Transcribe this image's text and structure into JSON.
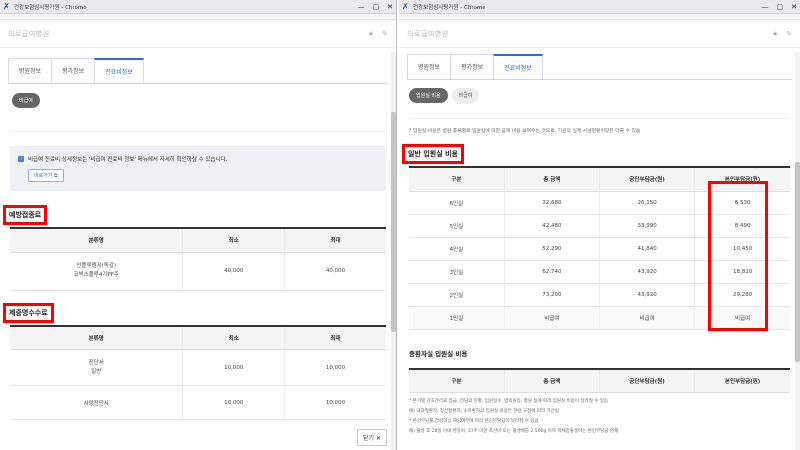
{
  "left": {
    "window_title": "건강보험심사평가원 - Chrome",
    "page_title": "의료급여병원",
    "tabs": [
      {
        "label": "병원정보"
      },
      {
        "label": "평가정보"
      },
      {
        "label": "진료비정보"
      }
    ],
    "chip": "비급여",
    "notice_text": "비급여 진료비 상세정보는 '비급여 진료비 정보' 메뉴에서 자세히 확인하실 수 있습니다.",
    "notice_button": "바로가기",
    "section1": {
      "title": "예방접종료",
      "headers": [
        "분류명",
        "최소",
        "최대"
      ],
      "rows": [
        [
          "인플루엔자(독감)\n코박스플루4가PF주",
          "40,000",
          "40,000"
        ]
      ]
    },
    "section2": {
      "title": "제증명수수료",
      "headers": [
        "분류명",
        "최소",
        "최대"
      ],
      "rows": [
        [
          "진단서\n일반",
          "10,000",
          "10,000"
        ],
        [
          "사망진단서",
          "10,000",
          "10,000"
        ]
      ]
    },
    "close_label": "닫기"
  },
  "right": {
    "window_title": "건강보험심사평가원 - Chrome",
    "page_title": "의료급여병원",
    "tabs": [
      {
        "label": "병원정보"
      },
      {
        "label": "평가정보"
      },
      {
        "label": "진료비정보"
      }
    ],
    "chips": [
      "입원실 비용",
      "비급여"
    ],
    "description": "* 입원실 비용은 병원 종류별로 입원실에 대한 금액 비용 보여주는 것으로, 기관의 실제 시설현황이랑은 다를 수 있음",
    "section1": {
      "title": "일반 입원실 비용",
      "headers": [
        "구분",
        "총 금액",
        "공단부담금(원)",
        "본인부담금(원)"
      ],
      "rows": [
        [
          "6인실",
          "32,680",
          "26,150",
          "6,530"
        ],
        [
          "5인실",
          "42,480",
          "33,990",
          "8,490"
        ],
        [
          "4인실",
          "52,290",
          "41,840",
          "10,450"
        ],
        [
          "3인실",
          "62,740",
          "43,920",
          "18,820"
        ],
        [
          "2인실",
          "73,200",
          "43,920",
          "29,280"
        ],
        [
          "1인실",
          "비급여",
          "비급여",
          "비급여"
        ]
      ]
    },
    "section2": {
      "title": "중환자실 입원실 비용",
      "headers": [
        "구분",
        "총 금액",
        "공단부담금(원)",
        "본인부담금(원)"
      ]
    },
    "notes": [
      "* 본기별 간호관리료 등급, 전담의 현황, 입원일수, 병의원등, 병원 등에 따라 입원실 비용이 달라질 수 있음",
      "  예) 내과질환자, 정신질환자, 소아환자의 입원실 비용은 관련 규정에 따라 가산됨",
      "* 본인부담률 경감대상 해당여부에 따라 본인부담금이 달라질 수 있음",
      "  예) 출생 후 28일 이내 영유아, 37주 미만 조산아 또는 출생체중 2,500g 이하 저체중출생아는 본인부담금 면제"
    ]
  },
  "icons": {
    "left": [
      "chrome-app-icon",
      "minimize-icon",
      "maximize-icon",
      "close-icon",
      "star-icon",
      "edit-icon"
    ],
    "right": [
      "chrome-app-icon",
      "minimize-icon",
      "maximize-icon",
      "close-icon",
      "star-icon",
      "edit-icon"
    ]
  },
  "colors": {
    "highlight": "#ff0000",
    "accent": "#2c6ed5"
  }
}
